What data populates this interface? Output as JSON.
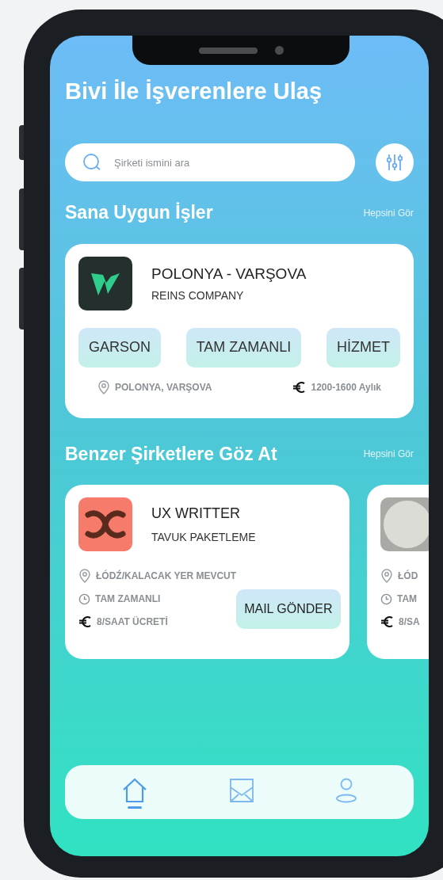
{
  "header": {
    "title": "Bivi İle İşverenlere Ulaş"
  },
  "search": {
    "placeholder": "Şirketi ismini ara"
  },
  "jobs_section": {
    "title": "Sana Uygun İşler",
    "link": "Hepsini Gör",
    "job": {
      "title": "POLONYA - VARŞOVA",
      "company": "REINS COMPANY",
      "tags": [
        "GARSON",
        "TAM ZAMANLI",
        "HİZMET"
      ],
      "location": "POLONYA, VARŞOVA",
      "salary": "1200-1600 Aylık"
    }
  },
  "companies_section": {
    "title": "Benzer Şirketlere Göz At",
    "link": "Hepsini Gör",
    "cards": [
      {
        "kind": "knot",
        "title": "UX WRITTER",
        "subtitle": "TAVUK PAKETLEME",
        "location": "ŁÓDŹ/KALACAK YER MEVCUT",
        "hours": "TAM ZAMANLI",
        "pay": "8/SAAT ÜCRETİ",
        "action": "MAIL GÖNDER"
      },
      {
        "kind": "plate",
        "location": "ŁÓD",
        "hours": "TAM",
        "pay": "8/SA"
      }
    ]
  },
  "nav": [
    {
      "kind": "home",
      "selected": true
    },
    {
      "kind": "mail",
      "selected": false
    },
    {
      "kind": "profile",
      "selected": false
    }
  ]
}
